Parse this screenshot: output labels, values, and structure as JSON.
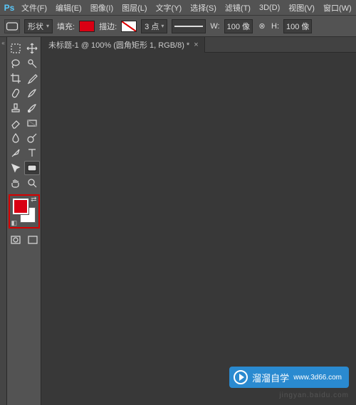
{
  "app": {
    "logo": "Ps"
  },
  "menu": {
    "items": [
      "文件(F)",
      "编辑(E)",
      "图像(I)",
      "图层(L)",
      "文字(Y)",
      "选择(S)",
      "滤镜(T)",
      "3D(D)",
      "视图(V)",
      "窗口(W)"
    ]
  },
  "opt": {
    "shape_mode": "形状",
    "fill_label": "填充:",
    "stroke_label": "描边:",
    "stroke_width": "3 点",
    "w_label": "W:",
    "w_value": "100 像",
    "h_label": "H:",
    "h_value": "100 像"
  },
  "doc": {
    "title": "未标题-1 @ 100% (圆角矩形 1, RGB/8) *"
  },
  "colors": {
    "fg": "#d90013",
    "bg": "#ffffff"
  },
  "watermark": {
    "brand": "溜溜自学",
    "site": "www.3d66.com"
  }
}
